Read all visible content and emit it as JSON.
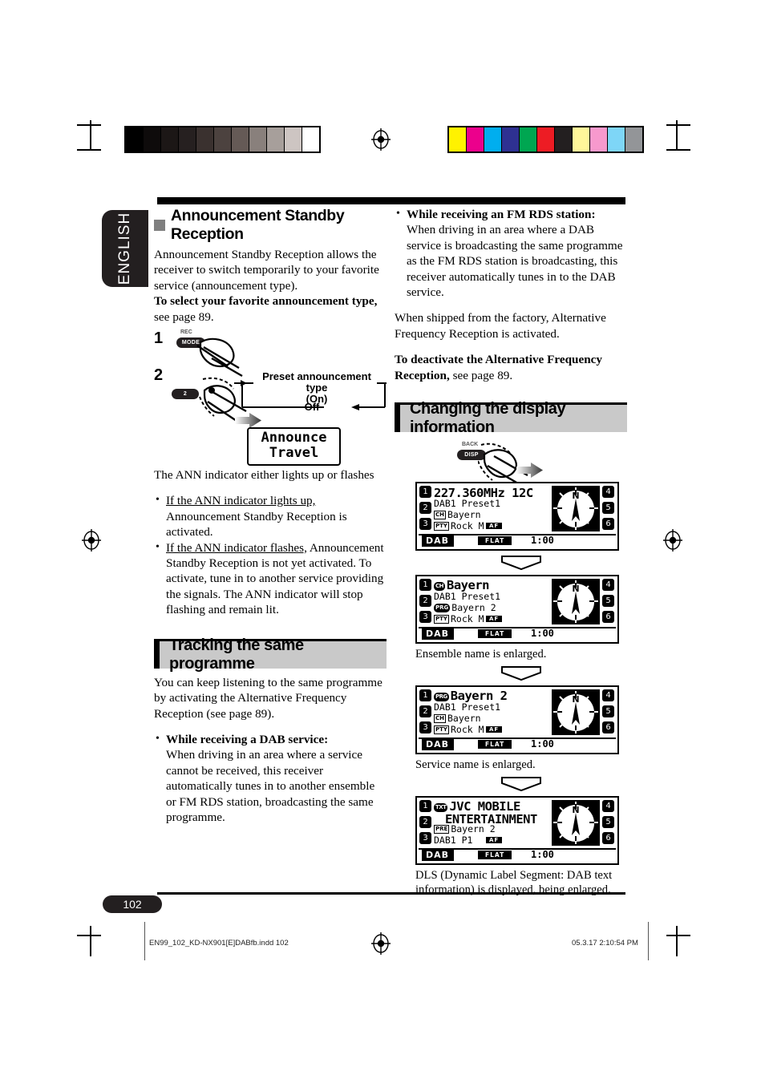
{
  "document": {
    "language_tab": "ENGLISH",
    "page_number": "102",
    "footer_file": "EN99_102_KD-NX901[E]DABfb.indd   102",
    "footer_date": "05.3.17   2:10:54 PM"
  },
  "calibration": {
    "gray_bar": [
      "#000000",
      "#0e0b0b",
      "#1c1716",
      "#262020",
      "#3a312f",
      "#4c423f",
      "#655a56",
      "#89807c",
      "#a79f9b",
      "#cdc5c2",
      "#ffffff"
    ],
    "color_bar": [
      "#fff200",
      "#ec008c",
      "#00aeef",
      "#2e3192",
      "#00a651",
      "#ed1c24",
      "#231f20",
      "#fff79a",
      "#f799cd",
      "#7ed6f7",
      "#939598"
    ]
  },
  "left_column": {
    "section1": {
      "heading": "Announcement Standby Reception",
      "paragraph1": "Announcement Standby Reception allows the receiver to switch temporarily to your favorite service (announcement type).",
      "bold_lead": "To select your favorite announcement type,",
      "bold_tail": " see page 89.",
      "steps": {
        "step1_number": "1",
        "step1_button_caption": "REC",
        "step1_button_label": "MODE",
        "step2_number": "2",
        "step2_button_label": "2",
        "flow_top_line1": "Preset announcement type",
        "flow_top_line2": "(On)",
        "flow_bottom": "Off",
        "lcd_line1": "Announce",
        "lcd_line2": "Travel"
      },
      "after_steps": "The ANN indicator either lights up or flashes",
      "bullets": [
        {
          "underlined": "If the ANN indicator lights up,",
          "rest": " Announcement Standby Reception is activated."
        },
        {
          "underlined": "If the ANN indicator flashes,",
          "rest": " Announcement Standby Reception is not yet activated. To activate, tune in to another service providing the signals. The ANN indicator will stop flashing and remain lit."
        }
      ]
    },
    "section2": {
      "banner": "Tracking the same programme",
      "paragraph1": "You can keep listening to the same programme by activating the Alternative Frequency Reception (see page 89).",
      "bullet_bold": "While receiving a DAB service:",
      "bullet_text": "When driving in an area where a service cannot be received, this receiver automatically tunes in to another ensemble or FM RDS station, broadcasting the same programme."
    }
  },
  "right_column": {
    "bullet_bold": "While receiving an FM RDS station:",
    "bullet_text": "When driving in an area where a DAB service is broadcasting the same programme as the FM RDS station is broadcasting, this receiver automatically tunes in to the DAB service.",
    "paragraph1": "When shipped from the factory, Alternative Frequency Reception is activated.",
    "bold_lead": "To deactivate the Alternative Frequency Reception,",
    "bold_tail": " see page 89.",
    "banner": "Changing the display information",
    "button_caption": "BACK",
    "button_label": "DISP",
    "displays": [
      {
        "lines": [
          {
            "tag": "",
            "text": "227.360MHz    12C",
            "big": true
          },
          {
            "tag": "",
            "text": "DAB1   Preset1",
            "big": false
          },
          {
            "tag": "CH",
            "text": "Bayern",
            "big": false
          },
          {
            "tag": "PTY",
            "text": "Rock M",
            "big": false
          }
        ],
        "af": "AF",
        "source": "DAB",
        "eq": "FLAT",
        "clock": "1:00",
        "compass": "N",
        "numbers_left": [
          "1",
          "2",
          "3"
        ],
        "numbers_right": [
          "4",
          "5",
          "6"
        ],
        "caption": ""
      },
      {
        "lines": [
          {
            "tag": "CH",
            "text": "Bayern",
            "big": true
          },
          {
            "tag": "",
            "text": "DAB1   Preset1",
            "big": false
          },
          {
            "tag": "PRG",
            "text": "Bayern 2",
            "big": false
          },
          {
            "tag": "PTY",
            "text": "Rock M",
            "big": false
          }
        ],
        "af": "AF",
        "source": "DAB",
        "eq": "FLAT",
        "clock": "1:00",
        "compass": "N",
        "numbers_left": [
          "1",
          "2",
          "3"
        ],
        "numbers_right": [
          "4",
          "5",
          "6"
        ],
        "caption": "Ensemble name is enlarged."
      },
      {
        "lines": [
          {
            "tag": "PRG",
            "text": "Bayern 2",
            "big": true
          },
          {
            "tag": "",
            "text": "DAB1   Preset1",
            "big": false
          },
          {
            "tag": "CH",
            "text": "Bayern",
            "big": false
          },
          {
            "tag": "PTY",
            "text": "Rock M",
            "big": false
          }
        ],
        "af": "AF",
        "source": "DAB",
        "eq": "FLAT",
        "clock": "1:00",
        "compass": "N",
        "numbers_left": [
          "1",
          "2",
          "3"
        ],
        "numbers_right": [
          "4",
          "5",
          "6"
        ],
        "caption": "Service name is enlarged."
      },
      {
        "lines": [
          {
            "tag": "TXT",
            "text": "JVC MOBILE",
            "big": true
          },
          {
            "tag": "",
            "text": "ENTERTAINMENT",
            "big": true
          },
          {
            "tag": "PRE",
            "text": "Bayern 2",
            "big": false
          },
          {
            "tag": "",
            "text": "DAB1  P1",
            "big": false
          }
        ],
        "af": "AF",
        "source": "DAB",
        "eq": "FLAT",
        "clock": "1:00",
        "compass": "N",
        "numbers_left": [
          "1",
          "2",
          "3"
        ],
        "numbers_right": [
          "4",
          "5",
          "6"
        ],
        "caption": "DLS (Dynamic Label Segment: DAB text information) is displayed, being enlarged."
      }
    ]
  }
}
